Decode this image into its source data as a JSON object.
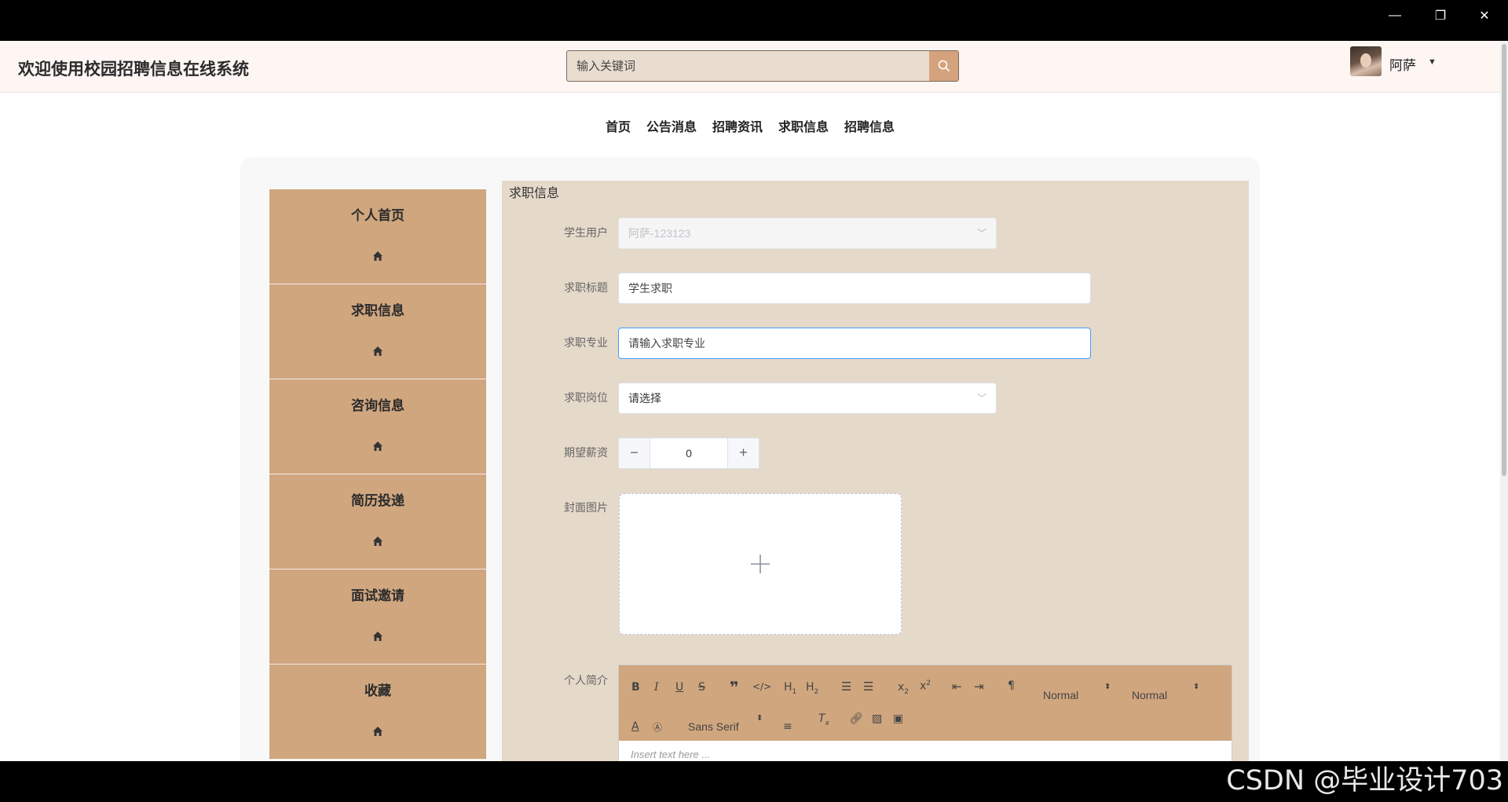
{
  "window": {
    "minimize_glyph": "—",
    "restore_glyph": "❐",
    "close_glyph": "✕"
  },
  "header": {
    "title": "欢迎使用校园招聘信息在线系统",
    "search_placeholder": "输入关键词",
    "search_icon": "search-icon",
    "username": "阿萨"
  },
  "nav": {
    "items": [
      "首页",
      "公告消息",
      "招聘资讯",
      "求职信息",
      "招聘信息"
    ]
  },
  "sidebar": {
    "items": [
      {
        "label": "个人首页",
        "icon": "home-icon"
      },
      {
        "label": "求职信息",
        "icon": "home-icon"
      },
      {
        "label": "咨询信息",
        "icon": "home-icon"
      },
      {
        "label": "简历投递",
        "icon": "home-icon"
      },
      {
        "label": "面试邀请",
        "icon": "home-icon"
      },
      {
        "label": "收藏",
        "icon": "home-icon"
      }
    ]
  },
  "form": {
    "title": "求职信息",
    "student_label": "学生用户",
    "student_value": "阿萨-123123",
    "title_label": "求职标题",
    "title_value": "学生求职",
    "major_label": "求职专业",
    "major_placeholder": "请输入求职专业",
    "position_label": "求职岗位",
    "position_value": "请选择",
    "salary_label": "期望薪资",
    "salary_value": "0",
    "cover_label": "封面图片",
    "intro_label": "个人简介",
    "editor_placeholder": "Insert text here ...",
    "toolbar": {
      "header_select_1": "Normal",
      "header_select_2": "Normal",
      "font_select": "Sans Serif"
    }
  },
  "colors": {
    "accent": "#d0a67f",
    "panel": "#e5d9ca",
    "header_bg": "#fdf6f3"
  },
  "watermark": "CSDN @毕业设计703"
}
